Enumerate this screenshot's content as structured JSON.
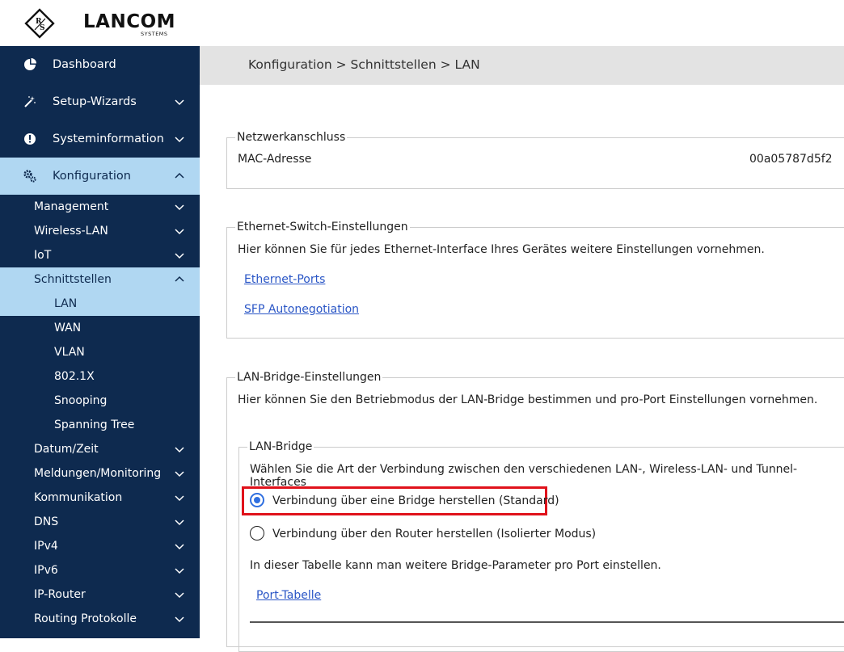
{
  "brand": {
    "name": "LANCOM",
    "sub": "SYSTEMS",
    "emblem": "R&S"
  },
  "sidebar": {
    "top_items": [
      {
        "label": "Dashboard",
        "icon": "dashboard-icon"
      },
      {
        "label": "Setup-Wizards",
        "icon": "wand-icon"
      },
      {
        "label": "Systeminformation",
        "icon": "info-icon"
      },
      {
        "label": "Konfiguration",
        "icon": "gears-icon"
      }
    ],
    "config_items": [
      {
        "label": "Management"
      },
      {
        "label": "Wireless-LAN"
      },
      {
        "label": "IoT"
      },
      {
        "label": "Schnittstellen"
      }
    ],
    "interface_items": [
      {
        "label": "LAN"
      },
      {
        "label": "WAN"
      },
      {
        "label": "VLAN"
      },
      {
        "label": "802.1X"
      },
      {
        "label": "Snooping"
      },
      {
        "label": "Spanning Tree"
      }
    ],
    "more_items": [
      {
        "label": "Datum/Zeit"
      },
      {
        "label": "Meldungen/Monitoring"
      },
      {
        "label": "Kommunikation"
      },
      {
        "label": "DNS"
      },
      {
        "label": "IPv4"
      },
      {
        "label": "IPv6"
      },
      {
        "label": "IP-Router"
      },
      {
        "label": "Routing Protokolle"
      }
    ]
  },
  "breadcrumb": "Konfiguration > Schnittstellen > LAN",
  "netz": {
    "legend": "Netzwerkanschluss",
    "mac_label": "MAC-Adresse",
    "mac_value": "00a05787d5f2"
  },
  "switch": {
    "legend": "Ethernet-Switch-Einstellungen",
    "desc": "Hier können Sie für jedes Ethernet-Interface Ihres Gerätes weitere Einstellungen vornehmen.",
    "link1": "Ethernet-Ports",
    "link2": "SFP Autonegotiation"
  },
  "bridge": {
    "legend": "LAN-Bridge-Einstellungen",
    "desc": "Hier können Sie den Betriebmodus der LAN-Bridge bestimmen und pro-Port Einstellungen vornehmen.",
    "inner_legend": "LAN-Bridge",
    "inner_desc": "Wählen Sie die Art der Verbindung zwischen den verschiedenen LAN-, Wireless-LAN- und Tunnel-Interfaces",
    "option1": "Verbindung über eine Bridge herstellen (Standard)",
    "option2": "Verbindung über den Router herstellen (Isolierter Modus)",
    "selected": "option1",
    "table_desc": "In dieser Tabelle kann man weitere Bridge-Parameter pro Port einstellen.",
    "table_link": "Port-Tabelle"
  },
  "colors": {
    "sidebar_bg": "#0e2a4f",
    "active_bg": "#b0d7f2",
    "highlight": "#e0121b",
    "link": "#2a56c6",
    "radio": "#2f6fe0"
  }
}
